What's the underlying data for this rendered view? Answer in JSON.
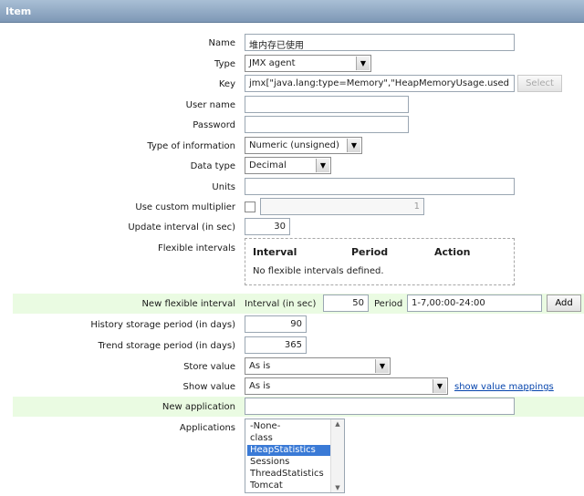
{
  "header": {
    "title": "Item"
  },
  "fields": {
    "name": {
      "label": "Name",
      "value": "堆内存已使用"
    },
    "type": {
      "label": "Type",
      "value": "JMX agent"
    },
    "key": {
      "label": "Key",
      "value": "jmx[\"java.lang:type=Memory\",\"HeapMemoryUsage.used",
      "select_label": "Select"
    },
    "username": {
      "label": "User name",
      "value": ""
    },
    "password": {
      "label": "Password",
      "value": ""
    },
    "type_of_information": {
      "label": "Type of information",
      "value": "Numeric (unsigned)"
    },
    "data_type": {
      "label": "Data type",
      "value": "Decimal"
    },
    "units": {
      "label": "Units",
      "value": ""
    },
    "custom_multiplier": {
      "label": "Use custom multiplier",
      "checked": false,
      "value": "1"
    },
    "update_interval": {
      "label": "Update interval (in sec)",
      "value": "30"
    }
  },
  "flexible_intervals": {
    "label": "Flexible intervals",
    "columns": [
      "Interval",
      "Period",
      "Action"
    ],
    "empty_text": "No flexible intervals defined."
  },
  "new_flexible_interval": {
    "label": "New flexible interval",
    "interval_label": "Interval (in sec)",
    "interval_value": "50",
    "period_label": "Period",
    "period_value": "1-7,00:00-24:00",
    "add_label": "Add"
  },
  "history": {
    "label": "History storage period (in days)",
    "value": "90"
  },
  "trend": {
    "label": "Trend storage period (in days)",
    "value": "365"
  },
  "store_value": {
    "label": "Store value",
    "value": "As is"
  },
  "show_value": {
    "label": "Show value",
    "value": "As is",
    "link": "show value mappings"
  },
  "new_application": {
    "label": "New application",
    "value": ""
  },
  "applications": {
    "label": "Applications",
    "options": [
      "-None-",
      "class",
      "HeapStatistics",
      "Sessions",
      "ThreadStatistics",
      "Tomcat"
    ],
    "selected": "HeapStatistics"
  },
  "colors": {
    "header": "#7e98b6",
    "highlight_row": "#eafbe2",
    "selected_option": "#3a7ad6",
    "link": "#0645ad"
  }
}
